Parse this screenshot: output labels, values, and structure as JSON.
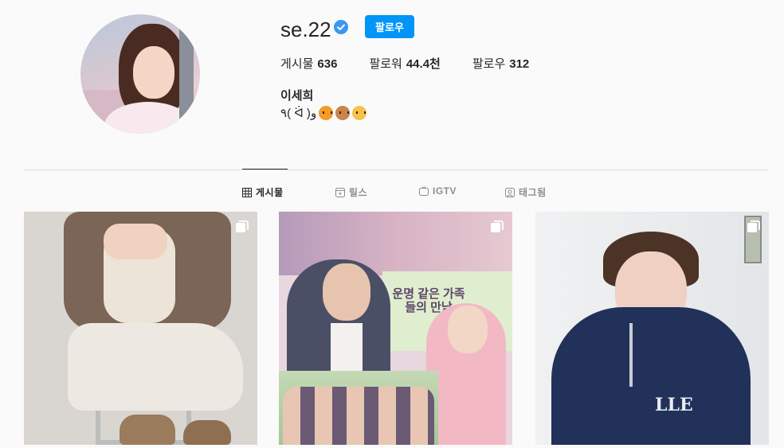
{
  "profile": {
    "username": "se.22",
    "verified": true,
    "follow_label": "팔로우",
    "name": "이세희",
    "bio_text": "٩( ᐛ )و",
    "bio_emojis": [
      "tiger-face-emoji",
      "dog-face-emoji",
      "cat-face-emoji"
    ]
  },
  "stats": [
    {
      "label": "게시물",
      "value": "636"
    },
    {
      "label": "팔로워",
      "value": "44.4천"
    },
    {
      "label": "팔로우",
      "value": "312"
    }
  ],
  "tabs": [
    {
      "label": "게시물",
      "icon": "grid-icon",
      "active": true
    },
    {
      "label": "릴스",
      "icon": "reels-icon",
      "active": false
    },
    {
      "label": "IGTV",
      "icon": "igtv-icon",
      "active": false
    },
    {
      "label": "태그됨",
      "icon": "tagged-icon",
      "active": false
    }
  ],
  "posts": [
    {
      "type": "carousel",
      "icon": "carousel-icon"
    },
    {
      "type": "carousel",
      "icon": "carousel-icon",
      "poster_title": "운명 같은 가족들의 만남"
    },
    {
      "type": "carousel",
      "icon": "carousel-icon",
      "logo_text": "LLE"
    }
  ],
  "colors": {
    "background": "#fafafa",
    "accent": "#0095f6",
    "verified_badge": "#3897f0",
    "text": "#262626",
    "muted": "#8e8e8e",
    "divider": "#dbdbdb"
  }
}
